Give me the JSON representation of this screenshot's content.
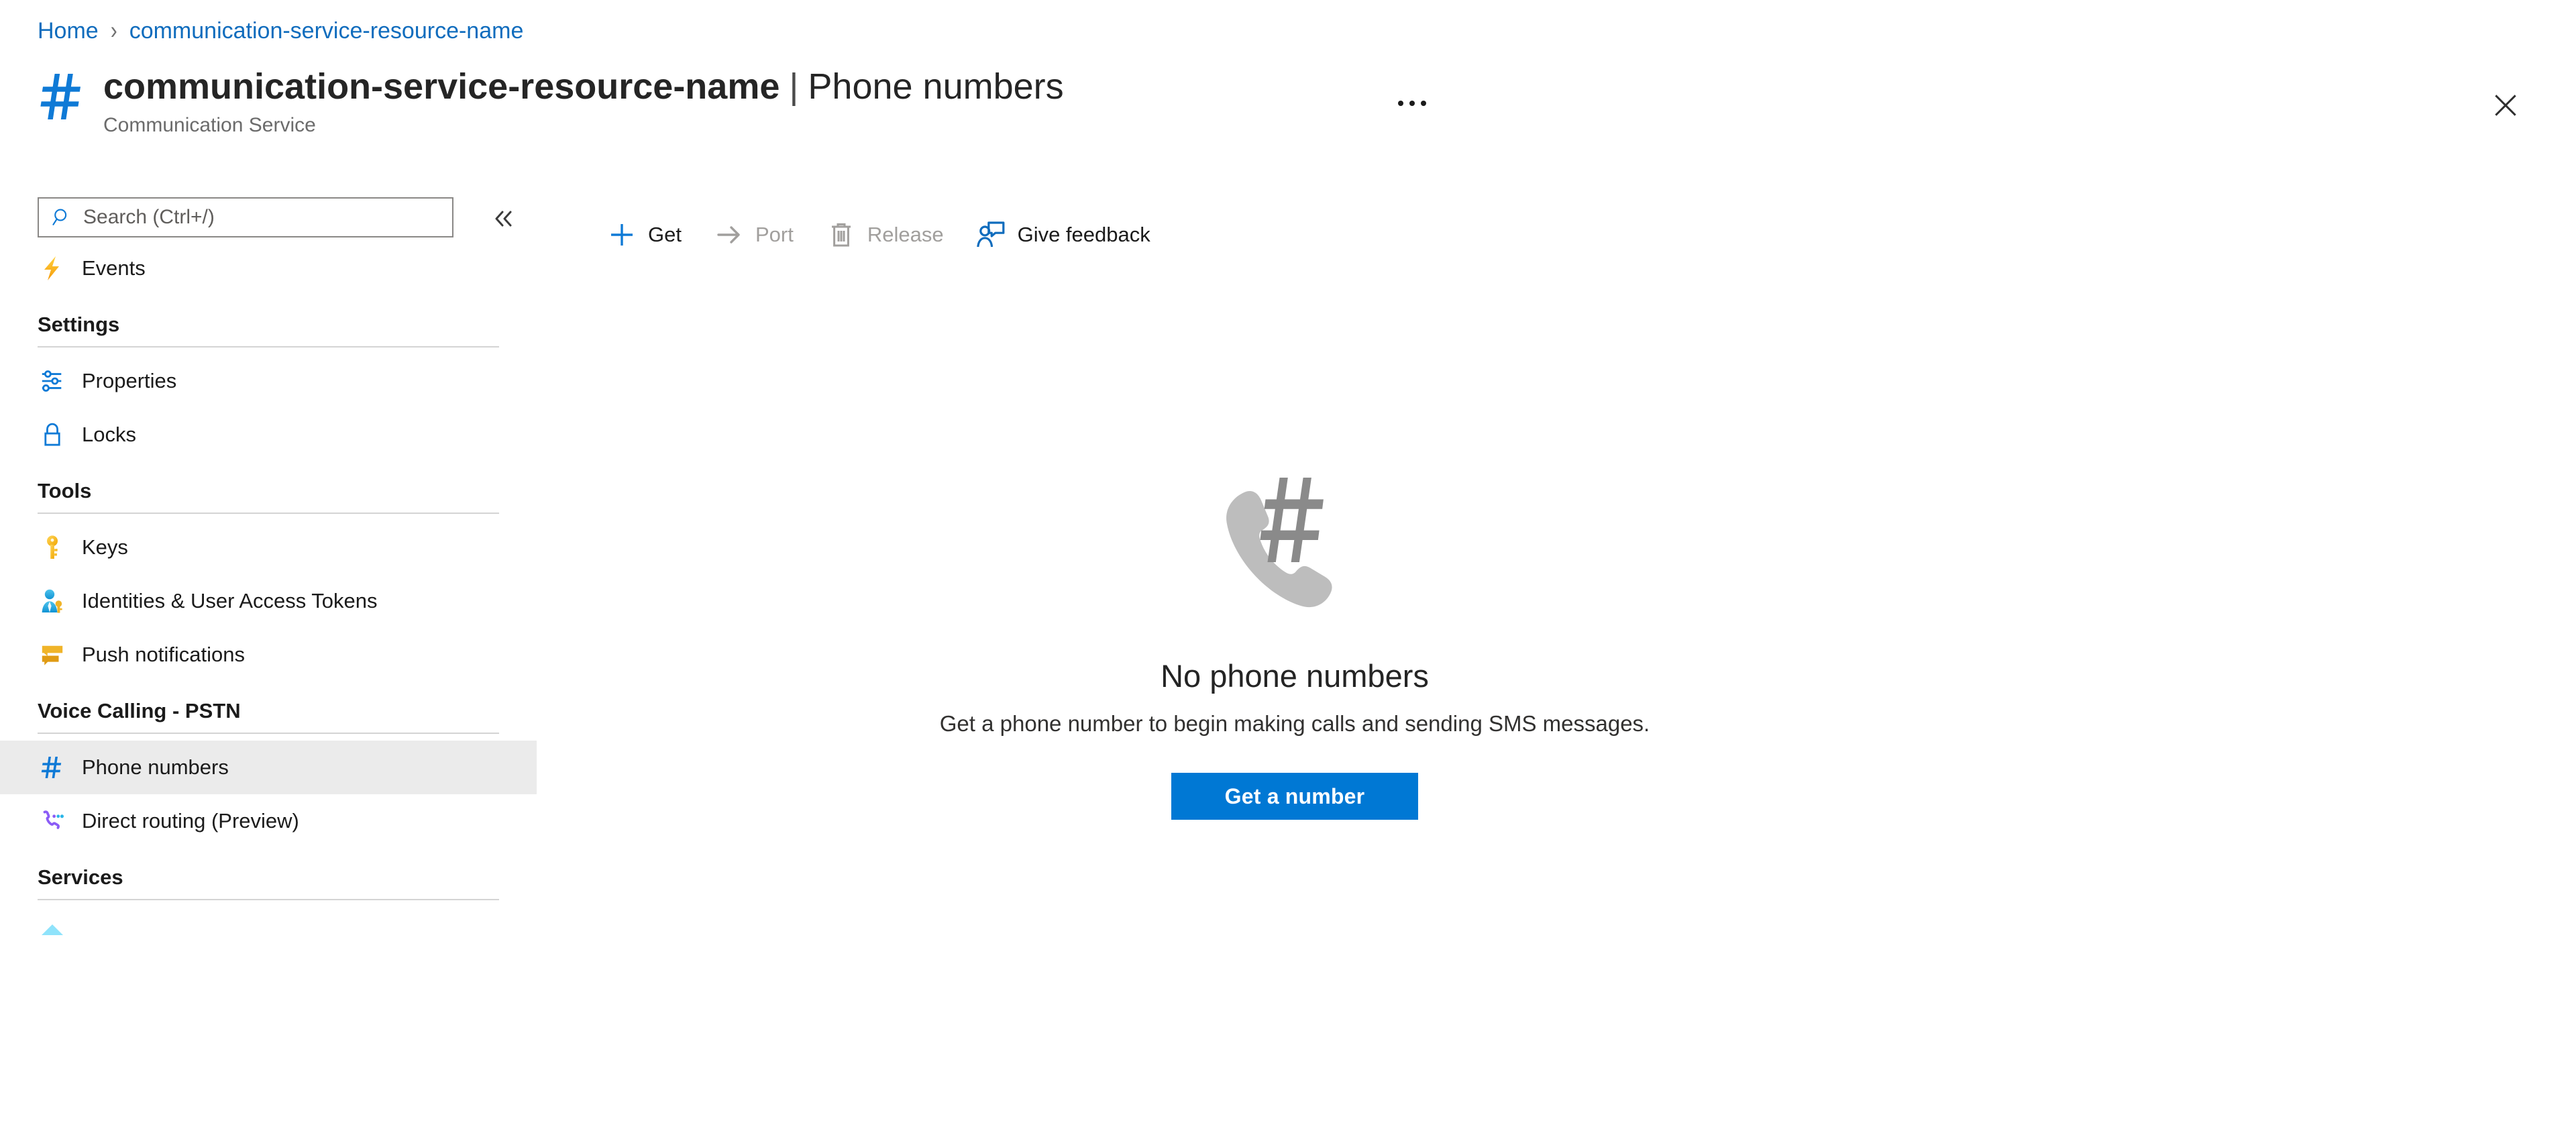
{
  "breadcrumb": {
    "items": [
      {
        "label": "Home",
        "icon": ""
      },
      {
        "label": "communication-service-resource-name",
        "icon": ""
      }
    ],
    "separator": "›"
  },
  "header": {
    "resource_icon": "hash-icon",
    "resource_name": "communication-service-resource-name",
    "separator": "|",
    "page_name": "Phone numbers",
    "subtitle": "Communication Service",
    "more_menu": "more-options-icon",
    "close_label": "close-icon"
  },
  "sidebar": {
    "search": {
      "placeholder": "Search (Ctrl+/)",
      "value": "",
      "icon": "search-icon"
    },
    "collapse": {
      "icon": "chevron-double-left-icon"
    },
    "top_items": [
      {
        "label": "Events",
        "icon": "lightning-bolt-icon",
        "selected": false
      }
    ],
    "groups": [
      {
        "title": "Settings",
        "items": [
          {
            "label": "Properties",
            "icon": "sliders-icon",
            "selected": false
          },
          {
            "label": "Locks",
            "icon": "lock-icon",
            "selected": false
          }
        ]
      },
      {
        "title": "Tools",
        "items": [
          {
            "label": "Keys",
            "icon": "key-icon",
            "selected": false
          },
          {
            "label": "Identities & User Access Tokens",
            "icon": "user-key-icon",
            "selected": false
          },
          {
            "label": "Push notifications",
            "icon": "push-notification-icon",
            "selected": false
          }
        ]
      },
      {
        "title": "Voice Calling - PSTN",
        "items": [
          {
            "label": "Phone numbers",
            "icon": "hash-icon",
            "selected": true
          },
          {
            "label": "Direct routing (Preview)",
            "icon": "phone-routing-icon",
            "selected": false
          }
        ]
      },
      {
        "title": "Services",
        "items": []
      }
    ]
  },
  "toolbar": {
    "buttons": [
      {
        "label": "Get",
        "icon": "plus-icon",
        "disabled": false
      },
      {
        "label": "Port",
        "icon": "arrow-right-icon",
        "disabled": true
      },
      {
        "label": "Release",
        "icon": "trash-icon",
        "disabled": true
      },
      {
        "label": "Give feedback",
        "icon": "feedback-person-icon",
        "disabled": false
      }
    ]
  },
  "empty_state": {
    "icon": "phone-hash-icon",
    "title": "No phone numbers",
    "description": "Get a phone number to begin making calls and sending SMS messages.",
    "action_label": "Get a number"
  },
  "colors": {
    "accent": "#0078d4",
    "link": "#0f6cbd",
    "selected_row": "#ebebeb",
    "disabled_text": "#a19f9d",
    "text": "#1b1b1b",
    "muted": "#6b6b6b"
  }
}
